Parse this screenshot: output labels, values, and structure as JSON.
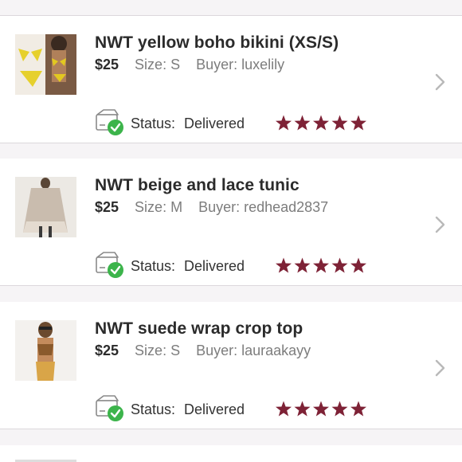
{
  "orders": [
    {
      "title": "NWT yellow boho bikini (XS/S)",
      "price": "$25",
      "size": "Size: S",
      "buyer": "Buyer: luxelily",
      "status_label": "Status:",
      "status_value": "Delivered",
      "rating": 5
    },
    {
      "title": "NWT beige and lace tunic",
      "price": "$25",
      "size": "Size: M",
      "buyer": "Buyer: redhead2837",
      "status_label": "Status:",
      "status_value": "Delivered",
      "rating": 5
    },
    {
      "title": "NWT suede wrap crop top",
      "price": "$25",
      "size": "Size: S",
      "buyer": "Buyer: lauraakayy",
      "status_label": "Status:",
      "status_value": "Delivered",
      "rating": 5
    }
  ],
  "icons": {
    "status": "package-delivered-icon",
    "rating": "star-icon",
    "navigate": "chevron-right-icon"
  },
  "colors": {
    "star": "#7e2236",
    "check": "#3cb44b",
    "chevron": "#b9b9b9",
    "background": "#f6f4f6"
  }
}
